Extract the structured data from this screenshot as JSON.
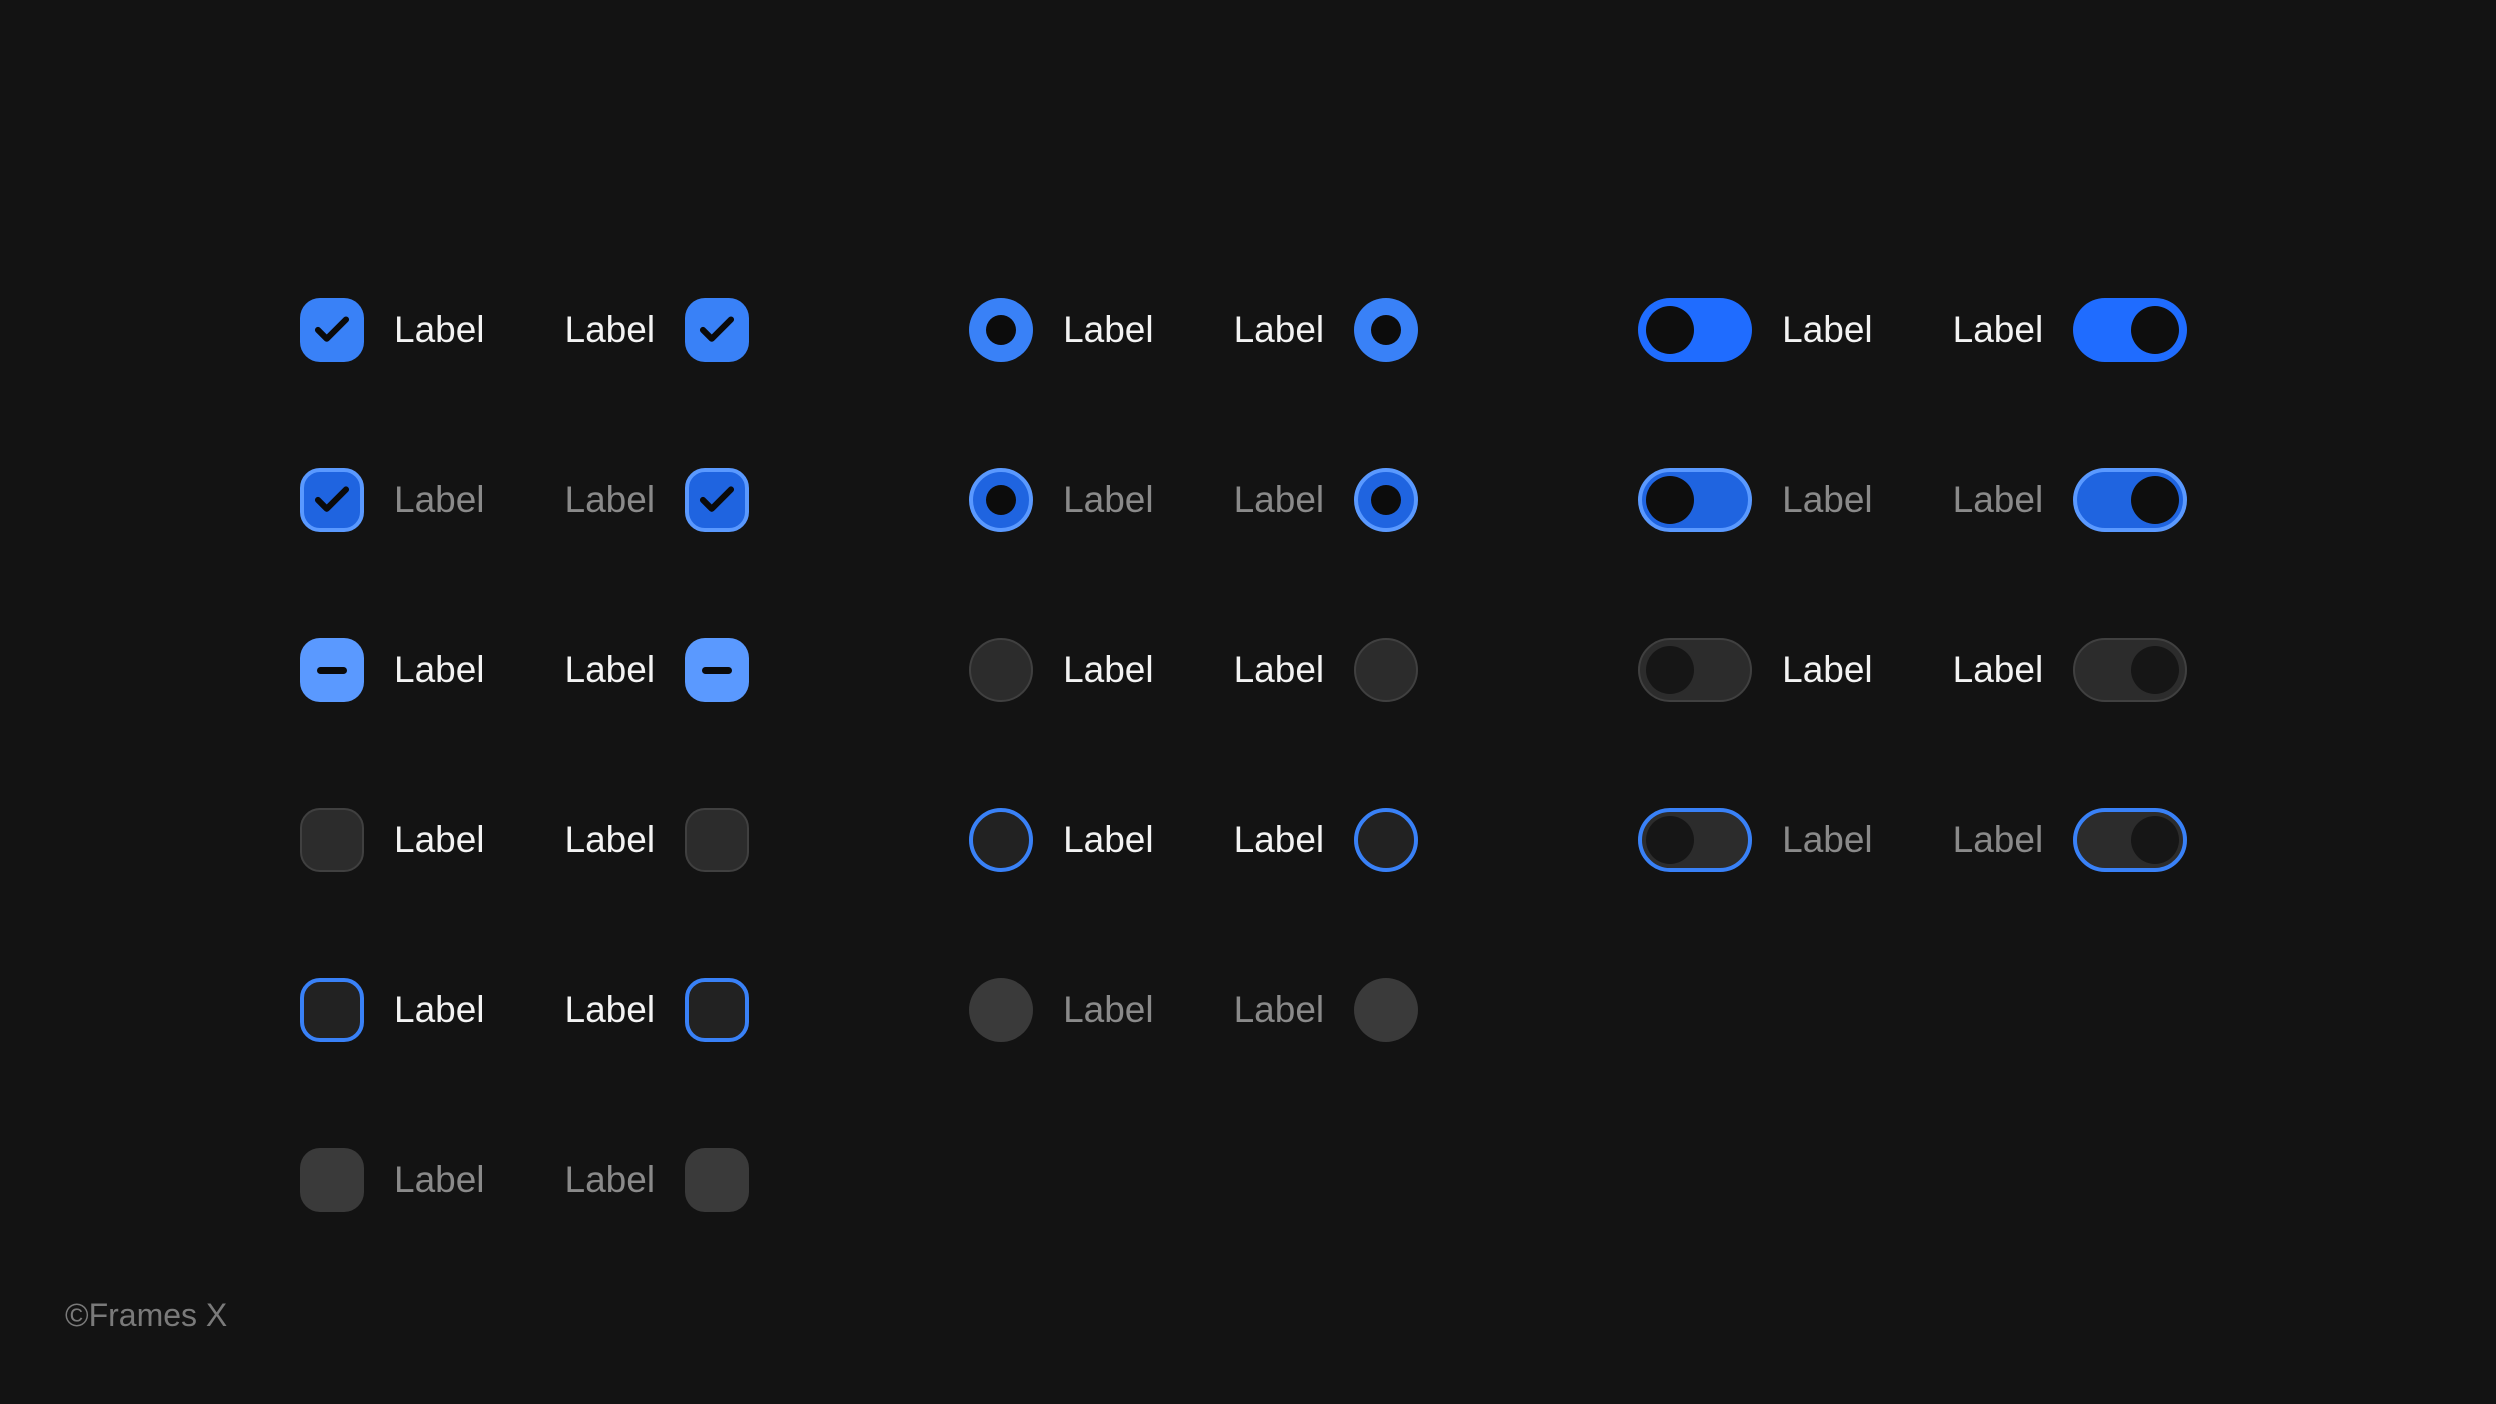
{
  "label_text": "Label",
  "credit": "©Frames X",
  "colors": {
    "accent": "#3981f7",
    "background": "#131313"
  },
  "checkboxes": {
    "states": [
      "checked",
      "checked-focused",
      "mixed",
      "empty",
      "empty-focused",
      "disabled"
    ],
    "positions": [
      "left",
      "right"
    ]
  },
  "radios": {
    "states": [
      "selected",
      "selected-focused",
      "unselected",
      "unselected-focused",
      "disabled"
    ],
    "positions": [
      "left",
      "right"
    ]
  },
  "toggles": {
    "states": [
      "on",
      "on-focused",
      "off",
      "off-focused"
    ],
    "positions": [
      "left",
      "right"
    ]
  }
}
